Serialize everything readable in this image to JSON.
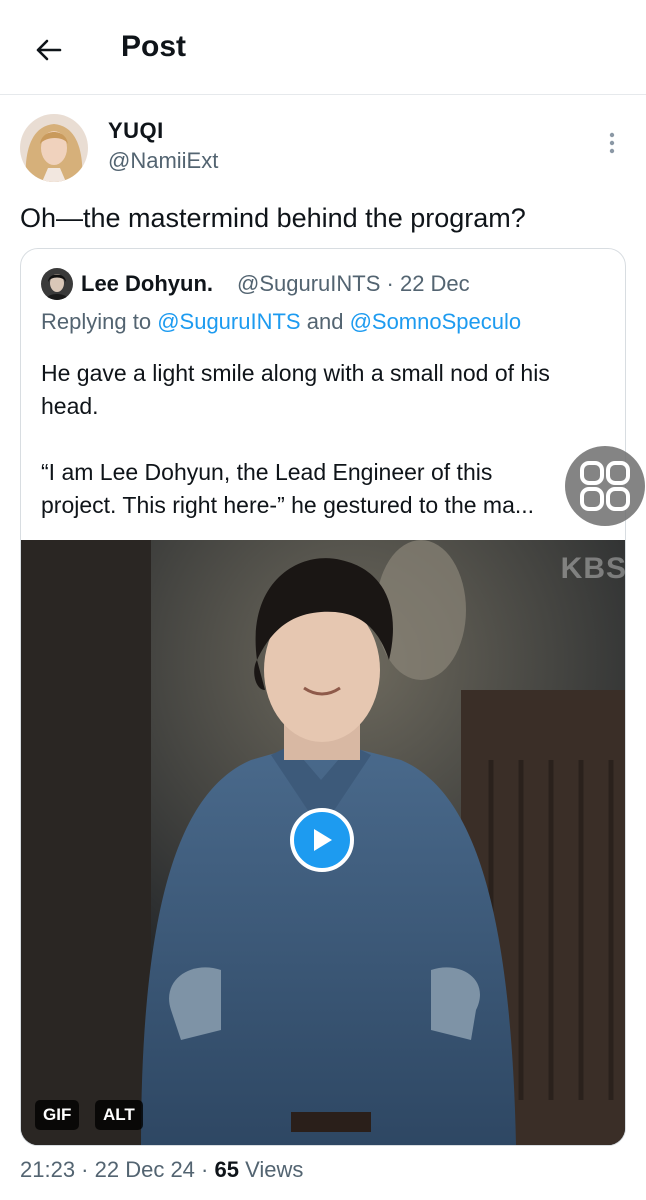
{
  "header": {
    "title": "Post",
    "back_icon": "arrow-left-icon"
  },
  "post": {
    "display_name": "YUQI",
    "handle": "@NamiiExt",
    "text": "Oh—the mastermind behind the program?",
    "more_icon": "vertical-ellipsis-icon"
  },
  "quote": {
    "author_name": "Lee Dohyun.",
    "author_handle": "@SuguruINTS",
    "date": "22 Dec",
    "replying_prefix": "Replying to",
    "mention1": "@SuguruINTS",
    "conjunction": "and",
    "mention2": "@SomnoSpeculo",
    "paragraph1": "He gave a light smile along with a small nod of his head.",
    "paragraph2_line1": "“I am Lee Dohyun, the Lead Engineer of this",
    "paragraph2_line2": "project. This right here-” he gestured to the ma..."
  },
  "media": {
    "watermark": "KBS",
    "gif_badge": "GIF",
    "alt_badge": "ALT",
    "play_icon": "play-icon"
  },
  "footer": {
    "time": "21:23",
    "date": "22 Dec 24",
    "views_count": "65",
    "views_label": "Views"
  },
  "colors": {
    "accent": "#1d9bf0",
    "secondary_text": "#536471",
    "primary_text": "#0f1419"
  }
}
